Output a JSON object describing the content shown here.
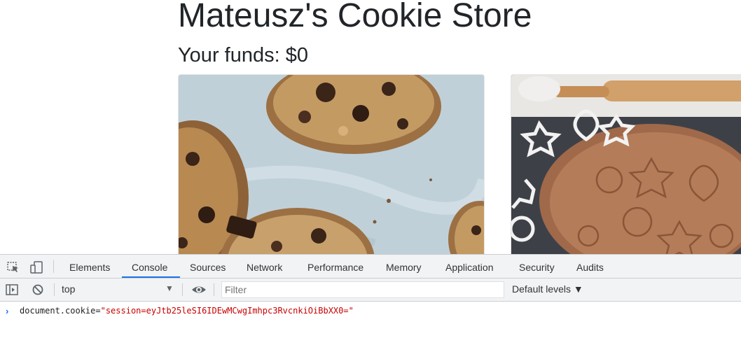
{
  "page": {
    "title": "Mateusz's Cookie Store",
    "funds_label": "Your funds: $0"
  },
  "devtools": {
    "tabs": [
      {
        "label": "Elements",
        "active": false
      },
      {
        "label": "Console",
        "active": true
      },
      {
        "label": "Sources",
        "active": false
      },
      {
        "label": "Network",
        "active": false
      },
      {
        "label": "Performance",
        "active": false
      },
      {
        "label": "Memory",
        "active": false
      },
      {
        "label": "Application",
        "active": false
      },
      {
        "label": "Security",
        "active": false
      },
      {
        "label": "Audits",
        "active": false
      }
    ],
    "toolbar": {
      "context": "top",
      "filter_placeholder": "Filter",
      "levels": "Default levels ▼"
    },
    "console": {
      "prompt": "›",
      "command_prefix": "document.cookie=",
      "command_string": "\"session=eyJtb25leSI6IDEwMCwgImhpc3RvcnkiOiBbXX0=\""
    },
    "icons": {
      "inspect": "inspect-element-icon",
      "device": "device-toolbar-icon",
      "sidebar": "console-sidebar-icon",
      "clear": "clear-console-icon",
      "eye": "live-expression-icon",
      "context_arrow": "dropdown-arrow-icon",
      "prompt": "console-prompt-icon"
    },
    "colors": {
      "accent": "#1a73e8",
      "string": "#c80000",
      "toolbar_bg": "#f1f3f4"
    }
  }
}
